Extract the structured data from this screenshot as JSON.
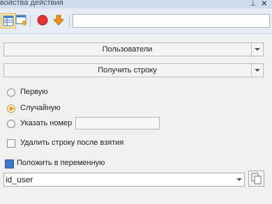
{
  "panel": {
    "title": "войства действия",
    "pin_icon": "pin-icon",
    "close_icon": "close-icon"
  },
  "toolbar": {
    "buttons": [
      "table-icon",
      "edit-window-icon",
      "stop-icon",
      "down-arrow-icon"
    ],
    "search_value": ""
  },
  "form": {
    "source_combo": "Пользователи",
    "action_combo": "Получить строку",
    "options": [
      {
        "label": "Первую",
        "selected": false
      },
      {
        "label": "Случайную",
        "selected": true
      },
      {
        "label": "Указать номер",
        "selected": false
      }
    ],
    "number_value": "",
    "delete_after": {
      "label": "Удалить строку после взятия",
      "checked": false
    },
    "put_into_variable": "Положить в переменную",
    "variable_value": "id_user"
  }
}
